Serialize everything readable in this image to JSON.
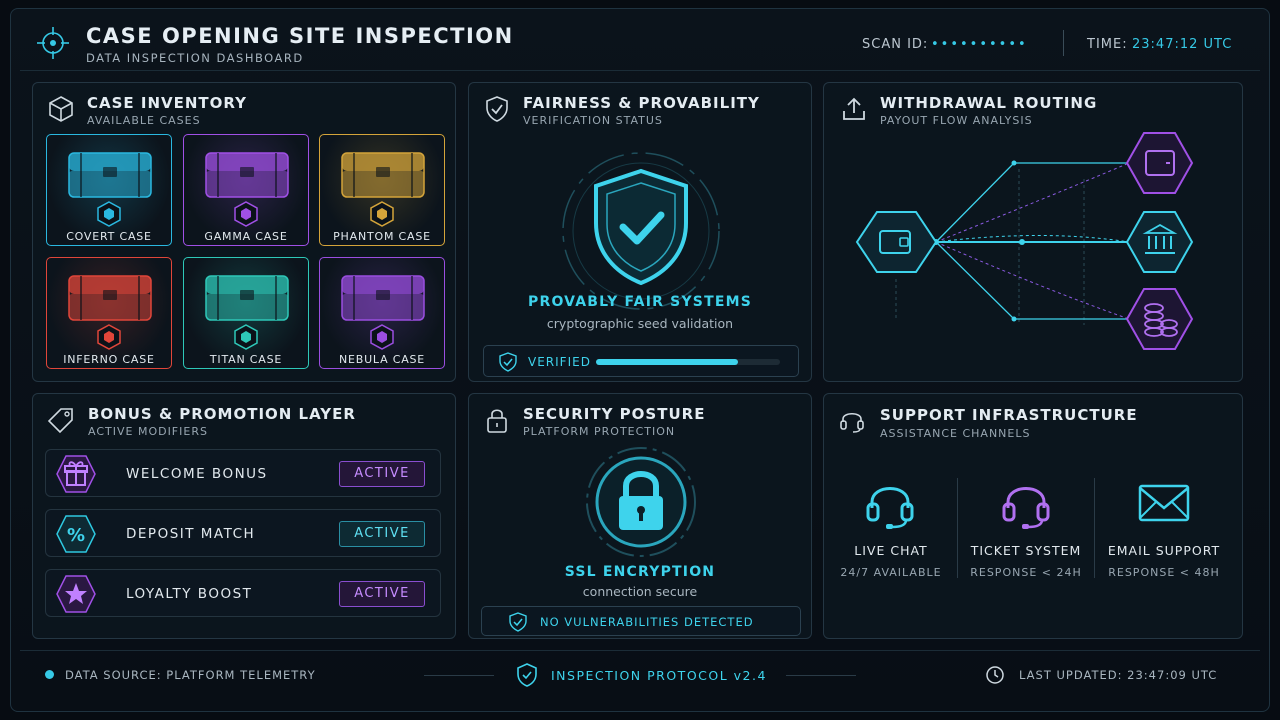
{
  "header": {
    "title": "CASE OPENING SITE INSPECTION",
    "subtitle": "DATA INSPECTION DASHBOARD",
    "scan_label": "SCAN ID:",
    "scan_value": "••••••••••",
    "time_label": "TIME:",
    "time_value": "23:47:12 UTC"
  },
  "inventory": {
    "title": "CASE INVENTORY",
    "subtitle": "AVAILABLE CASES",
    "cases": [
      {
        "label": "COVERT CASE",
        "color": "#2ab8e0"
      },
      {
        "label": "GAMMA CASE",
        "color": "#a050e6"
      },
      {
        "label": "PHANTOM CASE",
        "color": "#d4a43a"
      },
      {
        "label": "INFERNO CASE",
        "color": "#e0463a"
      },
      {
        "label": "TITAN CASE",
        "color": "#2ec8b8"
      },
      {
        "label": "NEBULA CASE",
        "color": "#9a4ee0"
      }
    ]
  },
  "fairness": {
    "title": "FAIRNESS & PROVABILITY",
    "subtitle": "VERIFICATION STATUS",
    "heading": "PROVABLY FAIR SYSTEMS",
    "caption": "cryptographic seed validation",
    "status": "VERIFIED",
    "progress": 0.77
  },
  "withdrawal": {
    "title": "WITHDRAWAL ROUTING",
    "subtitle": "PAYOUT FLOW ANALYSIS",
    "source_icon": "wallet-icon",
    "destinations": [
      "card-icon",
      "bank-icon",
      "coins-icon"
    ]
  },
  "bonus": {
    "title": "BONUS & PROMOTION LAYER",
    "subtitle": "ACTIVE MODIFIERS",
    "rows": [
      {
        "label": "WELCOME BONUS",
        "status": "ACTIVE",
        "icon": "gift-icon",
        "color": "#a050e6"
      },
      {
        "label": "DEPOSIT MATCH",
        "status": "ACTIVE",
        "icon": "percent-icon",
        "color": "#2ec8e0"
      },
      {
        "label": "LOYALTY BOOST",
        "status": "ACTIVE",
        "icon": "star-icon",
        "color": "#a050e6"
      }
    ]
  },
  "security": {
    "title": "SECURITY POSTURE",
    "subtitle": "PLATFORM PROTECTION",
    "heading": "SSL ENCRYPTION",
    "caption": "connection secure",
    "status": "NO VULNERABILITIES DETECTED"
  },
  "support": {
    "title": "SUPPORT INFRASTRUCTURE",
    "subtitle": "ASSISTANCE CHANNELS",
    "channels": [
      {
        "label": "LIVE CHAT",
        "sub": "24/7 AVAILABLE",
        "icon": "headset-icon"
      },
      {
        "label": "TICKET SYSTEM",
        "sub": "RESPONSE < 24H",
        "icon": "headset-icon"
      },
      {
        "label": "EMAIL SUPPORT",
        "sub": "RESPONSE < 48H",
        "icon": "envelope-icon"
      }
    ]
  },
  "footer": {
    "source": "DATA SOURCE: PLATFORM TELEMETRY",
    "protocol": "INSPECTION PROTOCOL v2.4",
    "updated": "LAST UPDATED: 23:47:09 UTC"
  }
}
